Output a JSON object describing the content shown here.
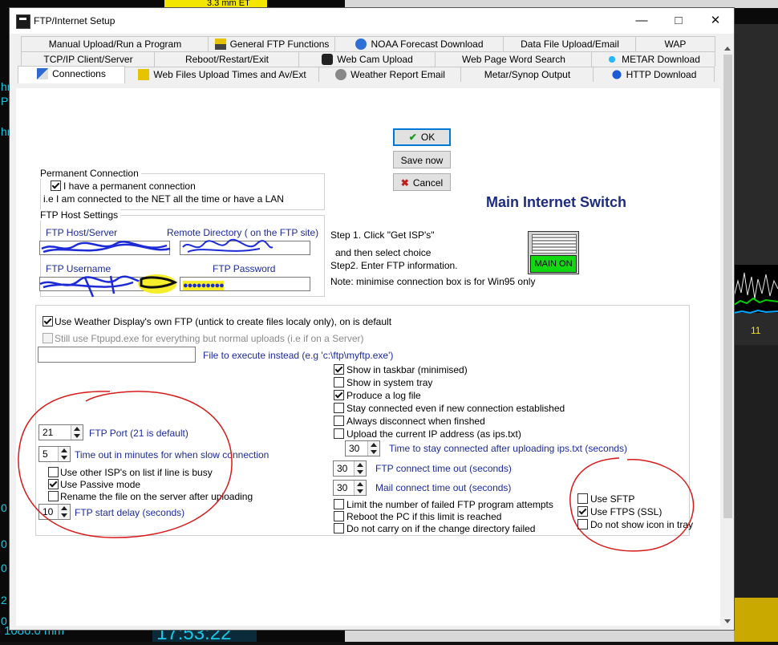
{
  "window": {
    "title": "FTP/Internet Setup"
  },
  "tabs_row1": [
    {
      "label": "Manual Upload/Run a Program"
    },
    {
      "label": "General FTP Functions"
    },
    {
      "label": "NOAA Forecast Download"
    },
    {
      "label": "Data File Upload/Email"
    },
    {
      "label": "WAP"
    }
  ],
  "tabs_row2": [
    {
      "label": "TCP/IP Client/Server"
    },
    {
      "label": "Reboot/Restart/Exit"
    },
    {
      "label": "Web Cam Upload"
    },
    {
      "label": "Web Page Word Search"
    },
    {
      "label": "METAR Download"
    }
  ],
  "tabs_row3": [
    {
      "label": "Connections"
    },
    {
      "label": "Web Files Upload Times and  Av/Ext"
    },
    {
      "label": "Weather Report Email"
    },
    {
      "label": "Metar/Synop Output"
    },
    {
      "label": "HTTP Download"
    }
  ],
  "buttons": {
    "ok": "OK",
    "save": "Save now",
    "cancel": "Cancel"
  },
  "main_switch": {
    "title": "Main Internet Switch",
    "state": "MAIN ON"
  },
  "steps": {
    "step1": "Step 1. Click  \"Get ISP's\"",
    "step1b": "and then select choice",
    "step2": "Step2. Enter FTP information.",
    "note": "Note: minimise connection box is for Win95 only"
  },
  "permanent": {
    "legend": "Permanent Connection",
    "checkbox": "I have a permanent connection",
    "checked": true,
    "info": "i.e I am connected to the NET all the time or have a LAN"
  },
  "ftp_host": {
    "legend": "FTP Host Settings",
    "host_label": "FTP Host/Server",
    "remote_label": "Remote Directory ( on the FTP site)",
    "user_label": "FTP Username",
    "pass_label": "FTP Password",
    "password_mask": "●●●●●●●●●"
  },
  "options": {
    "use_own_ftp": "Use Weather Display's own FTP  (untick to create files localy only), on is default",
    "still_use": "Still use Ftpupd.exe for everything but normal uploads (i.e if on a Server)",
    "file_exec": "File to execute instead (e.g 'c:\\ftp\\myftp.exe')"
  },
  "right_checks": [
    {
      "label": "Show in taskbar (minimised)",
      "checked": true
    },
    {
      "label": "Show in system tray",
      "checked": false
    },
    {
      "label": "Produce a log file",
      "checked": true
    },
    {
      "label": "Stay connected even if new connection established",
      "checked": false
    },
    {
      "label": "Always disconnect when finshed",
      "checked": false
    },
    {
      "label": "Upload the current IP address (as ips.txt)",
      "checked": false
    }
  ],
  "ip_stay": {
    "value": "30",
    "label": "Time to stay connected after uploading ips.txt (seconds)"
  },
  "connect_timeout": {
    "value": "30",
    "label": "FTP connect time out (seconds)"
  },
  "mail_timeout": {
    "value": "30",
    "label": "Mail connect time out (seconds)"
  },
  "bottom_checks": [
    {
      "label": "Limit the number of failed FTP program attempts",
      "checked": false
    },
    {
      "label": "Reboot the PC if this limit is reached",
      "checked": false
    },
    {
      "label": "Do not carry on if the change directory failed",
      "checked": false
    }
  ],
  "left_opts": {
    "port_value": "21",
    "port_label": "FTP Port (21 is default)",
    "timeout_value": "5",
    "timeout_label": "Time out in minutes for when slow connection",
    "other_isp": "Use other ISP's on list if line is busy",
    "passive": "Use Passive mode",
    "rename": "Rename the file on the server after uploading",
    "delay_value": "10",
    "delay_label": "FTP start delay (seconds)"
  },
  "ssl": [
    {
      "label": "Use SFTP",
      "checked": false
    },
    {
      "label": "Use FTPS (SSL)",
      "checked": true
    },
    {
      "label": "Do not show icon in tray",
      "checked": false
    }
  ],
  "background": {
    "top_readout": "3.3 mm ET",
    "bottom_left": "1086.0 mm",
    "bottom_clock": "17:53:22",
    "right_value": "11",
    "left_frag": [
      "hr",
      "P",
      "hr",
      "0",
      "0",
      "0",
      "2",
      "0"
    ]
  }
}
